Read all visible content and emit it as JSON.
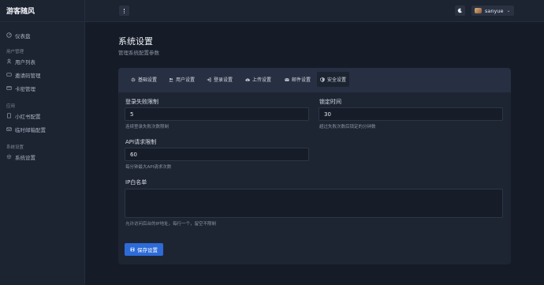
{
  "brand": "游客随风",
  "sidebar": {
    "dashboard": "仪表盘",
    "groups": [
      {
        "title": "用户管理",
        "items": [
          "用户列表",
          "邀请码管理",
          "卡密管理"
        ]
      },
      {
        "title": "应用",
        "items": [
          "小红书配置",
          "临时邮箱配置"
        ]
      },
      {
        "title": "系统设置",
        "items": [
          "系统设置"
        ]
      }
    ]
  },
  "topbar": {
    "username": "sanyue"
  },
  "page": {
    "title": "系统设置",
    "subtitle": "管理系统配置参数"
  },
  "tabs": [
    "基础设置",
    "用户设置",
    "登录设置",
    "上传设置",
    "邮件设置",
    "安全设置"
  ],
  "active_tab": "安全设置",
  "form": {
    "login_fail_limit": {
      "label": "登录失败限制",
      "value": "5",
      "help": "连续登录失败次数限制"
    },
    "lock_time": {
      "label": "锁定时间",
      "value": "30",
      "help": "超过失败次数后锁定的分钟数"
    },
    "api_rate_limit": {
      "label": "API请求限制",
      "value": "60",
      "help": "每分钟最大API请求次数"
    },
    "ip_whitelist": {
      "label": "IP白名单",
      "value": "",
      "help": "允许访问后台的IP地址，每行一个，留空不限制"
    },
    "save_label": "保存设置"
  }
}
